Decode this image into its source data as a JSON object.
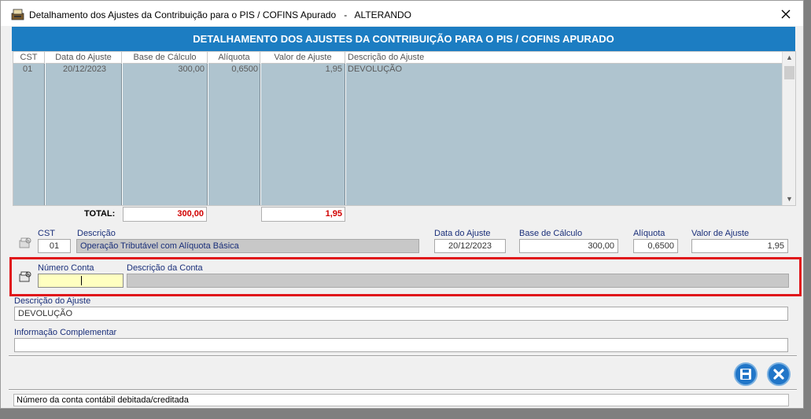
{
  "window": {
    "title": "Detalhamento dos Ajustes da Contribuição para o PIS / COFINS Apurado   -   ALTERANDO"
  },
  "header": {
    "title": "DETALHAMENTO DOS AJUSTES DA CONTRIBUIÇÃO PARA O PIS / COFINS APURADO"
  },
  "grid": {
    "columns": [
      "CST",
      "Data do Ajuste",
      "Base de Cálculo",
      "Alíquota",
      "Valor de Ajuste",
      "Descrição do Ajuste"
    ],
    "rows": [
      {
        "cst": "01",
        "data": "20/12/2023",
        "base": "300,00",
        "aliquota": "0,6500",
        "valor": "1,95",
        "descricao": "DEVOLUÇÃO"
      }
    ]
  },
  "totals": {
    "label": "TOTAL:",
    "base": "300,00",
    "valor": "1,95"
  },
  "form": {
    "cst_label": "CST",
    "cst_value": "01",
    "descricao_label": "Descrição",
    "descricao_value": "Operação Tributável com Alíquota Básica",
    "data_label": "Data do Ajuste",
    "data_value": "20/12/2023",
    "base_label": "Base de Cálculo",
    "base_value": "300,00",
    "aliquota_label": "Alíquota",
    "aliquota_value": "0,6500",
    "valor_label": "Valor de Ajuste",
    "valor_value": "1,95",
    "conta_label": "Número Conta",
    "conta_value": "",
    "desc_conta_label": "Descrição da Conta",
    "desc_conta_value": "",
    "desc_ajuste_label": "Descrição do Ajuste",
    "desc_ajuste_value": "DEVOLUÇÃO",
    "info_label": "Informação Complementar",
    "info_value": ""
  },
  "status": {
    "text": "Número da conta contábil debitada/creditada"
  },
  "colors": {
    "header_blue": "#1c7dc2",
    "grid_body": "#afc4cf",
    "highlight_red": "#e0151a",
    "total_red": "#d10000",
    "input_yellow": "#ffffc0"
  },
  "icons": {
    "app": "app-icon",
    "close": "close-icon",
    "save": "save-icon",
    "cancel": "cancel-icon",
    "search_cst": "search-icon",
    "search_conta": "search-icon"
  }
}
